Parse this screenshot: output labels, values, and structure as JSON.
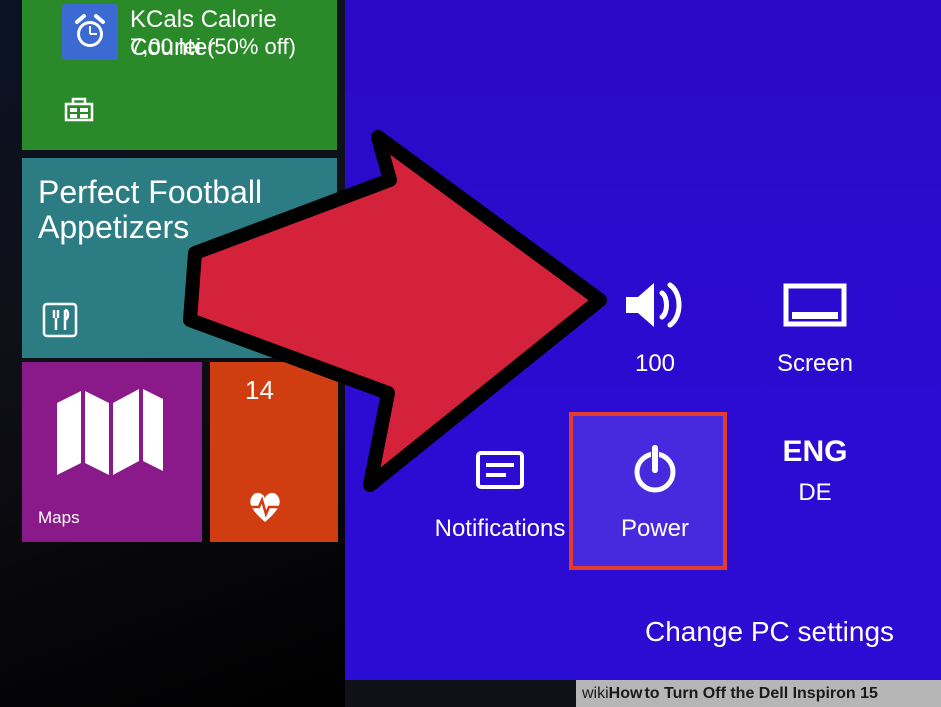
{
  "tiles": {
    "kcals": {
      "title": "KCals Calorie Counter",
      "subtitle": "7,00 lei (50% off)"
    },
    "teal": {
      "title": "Perfect Football\nAppetizers"
    },
    "maps": {
      "label": "Maps"
    },
    "orange": {
      "number": "14"
    }
  },
  "charms": {
    "volume_label": "100",
    "screen_label": "Screen",
    "notifications_label": "Notifications",
    "power_label": "Power",
    "lang_primary": "ENG",
    "lang_secondary": "DE"
  },
  "links": {
    "change_pc_settings": "Change PC settings"
  },
  "caption": {
    "wiki1": "wiki",
    "wiki2": "How",
    "rest": " to Turn Off the Dell Inspiron 15"
  }
}
